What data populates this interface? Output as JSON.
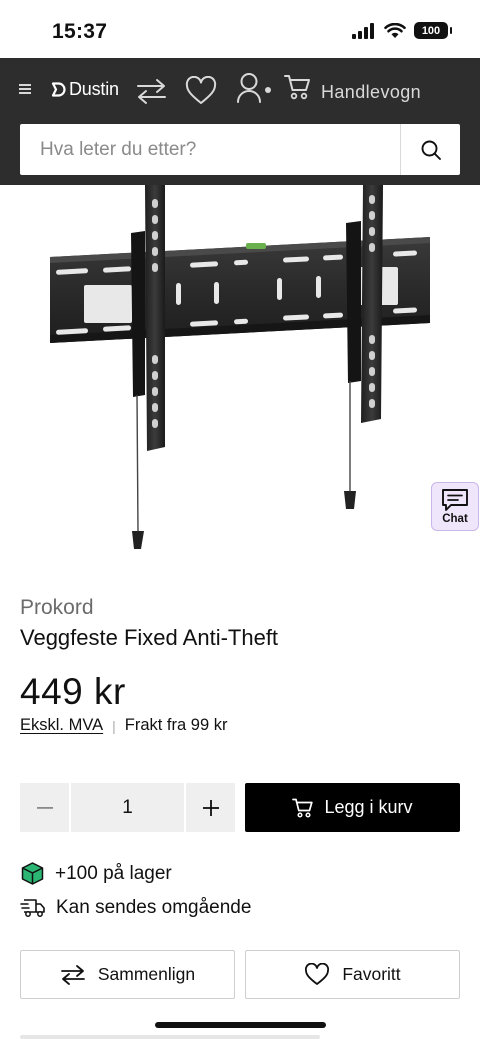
{
  "status_bar": {
    "time": "15:37",
    "battery": "100"
  },
  "header": {
    "logo": "Dustin",
    "cart_label": "Handlevogn",
    "search": {
      "placeholder": "Hva leter du etter?",
      "value": ""
    }
  },
  "chat": {
    "label": "Chat"
  },
  "product": {
    "brand": "Prokord",
    "title": "Veggfeste Fixed Anti-Theft",
    "price": "449 kr",
    "vat_label": "Ekskl. MVA",
    "shipping": "Frakt fra 99 kr",
    "quantity": "1",
    "add_to_cart_label": "Legg i kurv",
    "stock": "+100 på lager",
    "delivery": "Kan sendes omgående",
    "compare_label": "Sammenlign",
    "favorite_label": "Favoritt"
  },
  "colors": {
    "header_bg": "#2d2d2d",
    "chat_bg": "#f0e6fb",
    "stock_green": "#2bb673",
    "primary_button": "#000000"
  }
}
